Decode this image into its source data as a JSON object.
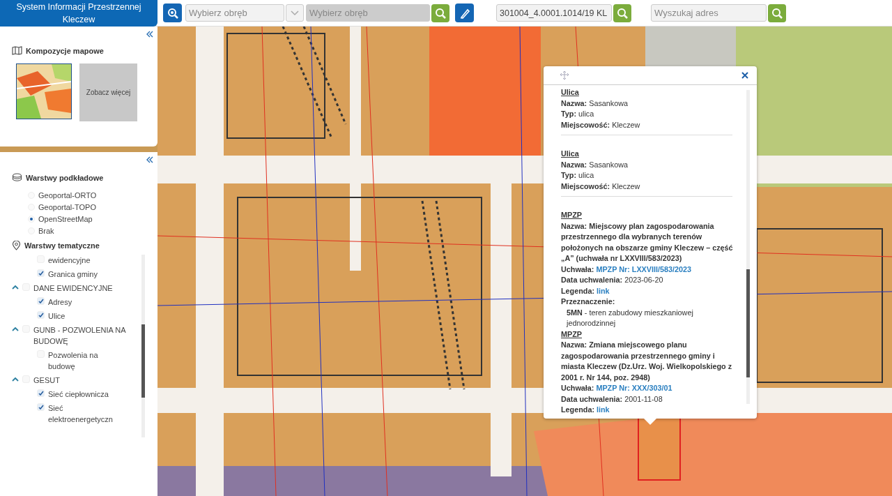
{
  "header": {
    "title": "System Informacji Przestrzennej Kleczew"
  },
  "toolbar": {
    "district_select": {
      "placeholder": "Wybierz obręb"
    },
    "district_field": {
      "placeholder": "Wybierz obręb",
      "disabled": true
    },
    "parcel_field": {
      "value": "301004_4.0001.1014/19 KL"
    },
    "address_field": {
      "placeholder": "Wyszukaj adres"
    }
  },
  "compositions": {
    "title": "Kompozycje mapowe",
    "more_label": "Zobacz więcej"
  },
  "base_layers": {
    "title": "Warstwy podkładowe",
    "options": [
      {
        "label": "Geoportal-ORTO",
        "selected": false
      },
      {
        "label": "Geoportal-TOPO",
        "selected": false
      },
      {
        "label": "OpenStreetMap",
        "selected": true
      },
      {
        "label": "Brak",
        "selected": false
      }
    ]
  },
  "thematic_layers": {
    "title": "Warstwy tematyczne",
    "items": [
      {
        "label": "ewidencyjne",
        "checked": false
      },
      {
        "label": "Granica gminy",
        "checked": true
      },
      {
        "label": "DANE EWIDENCYJNE",
        "checked": false,
        "expanded": true,
        "children": [
          {
            "label": "Adresy",
            "checked": true
          },
          {
            "label": "Ulice",
            "checked": true
          }
        ]
      },
      {
        "label": "GUNB - POZWOLENIA NA BUDOWĘ",
        "checked": false,
        "expanded": true,
        "children": [
          {
            "label": "Pozwolenia na budowę",
            "checked": false
          }
        ]
      },
      {
        "label": "GESUT",
        "checked": false,
        "expanded": true,
        "children": [
          {
            "label": "Sieć ciepłownicza",
            "checked": true
          },
          {
            "label": "Sieć elektroenergetyczn",
            "checked": true
          }
        ]
      }
    ]
  },
  "popup": {
    "sections": [
      {
        "title": "Ulica",
        "divider": true,
        "fields": [
          {
            "label": "Nazwa:",
            "value": "Sasankowa",
            "kind": "text"
          },
          {
            "label": "Typ:",
            "value": "ulica",
            "kind": "text"
          },
          {
            "label": "Miejscowość:",
            "value": "Kleczew",
            "kind": "text"
          }
        ]
      },
      {
        "title": "Ulica",
        "divider": true,
        "fields": [
          {
            "label": "Nazwa:",
            "value": "Sasankowa",
            "kind": "text"
          },
          {
            "label": "Typ:",
            "value": "ulica",
            "kind": "text"
          },
          {
            "label": "Miejscowość:",
            "value": "Kleczew",
            "kind": "text"
          }
        ]
      },
      {
        "title": "MPZP",
        "divider": false,
        "fields": [
          {
            "label": "Nazwa:",
            "value": "Miejscowy plan zagospodarowania przestrzennego dla wybranych terenów położonych na obszarze gminy Kleczew – część „A” (uchwała nr LXXVIII/583/2023)",
            "kind": "bold"
          },
          {
            "label": "Uchwała:",
            "value": "MPZP Nr: LXXVIII/583/2023",
            "kind": "link"
          },
          {
            "label": "Data uchwalenia:",
            "value": "2023-06-20",
            "kind": "text"
          },
          {
            "label": "Legenda:",
            "value": "link",
            "kind": "link"
          },
          {
            "label": "Przeznaczenie:",
            "value": "**5MN** - teren zabudowy mieszkaniowej jednorodzinnej",
            "kind": "block"
          }
        ]
      },
      {
        "title": "MPZP",
        "divider": false,
        "fields": [
          {
            "label": "Nazwa:",
            "value": "Zmiana miejscowego planu zagospodarowania przestrzennego gminy i miasta Kleczew (Dz.Urz. Woj. Wielkopolskiego z 2001 r. Nr 144, poz. 2948)",
            "kind": "bold"
          },
          {
            "label": "Uchwała:",
            "value": "MPZP Nr: XXX/303/01",
            "kind": "link"
          },
          {
            "label": "Data uchwalenia:",
            "value": "2001-11-08",
            "kind": "text"
          },
          {
            "label": "Legenda:",
            "value": "link",
            "kind": "link"
          }
        ]
      }
    ]
  }
}
